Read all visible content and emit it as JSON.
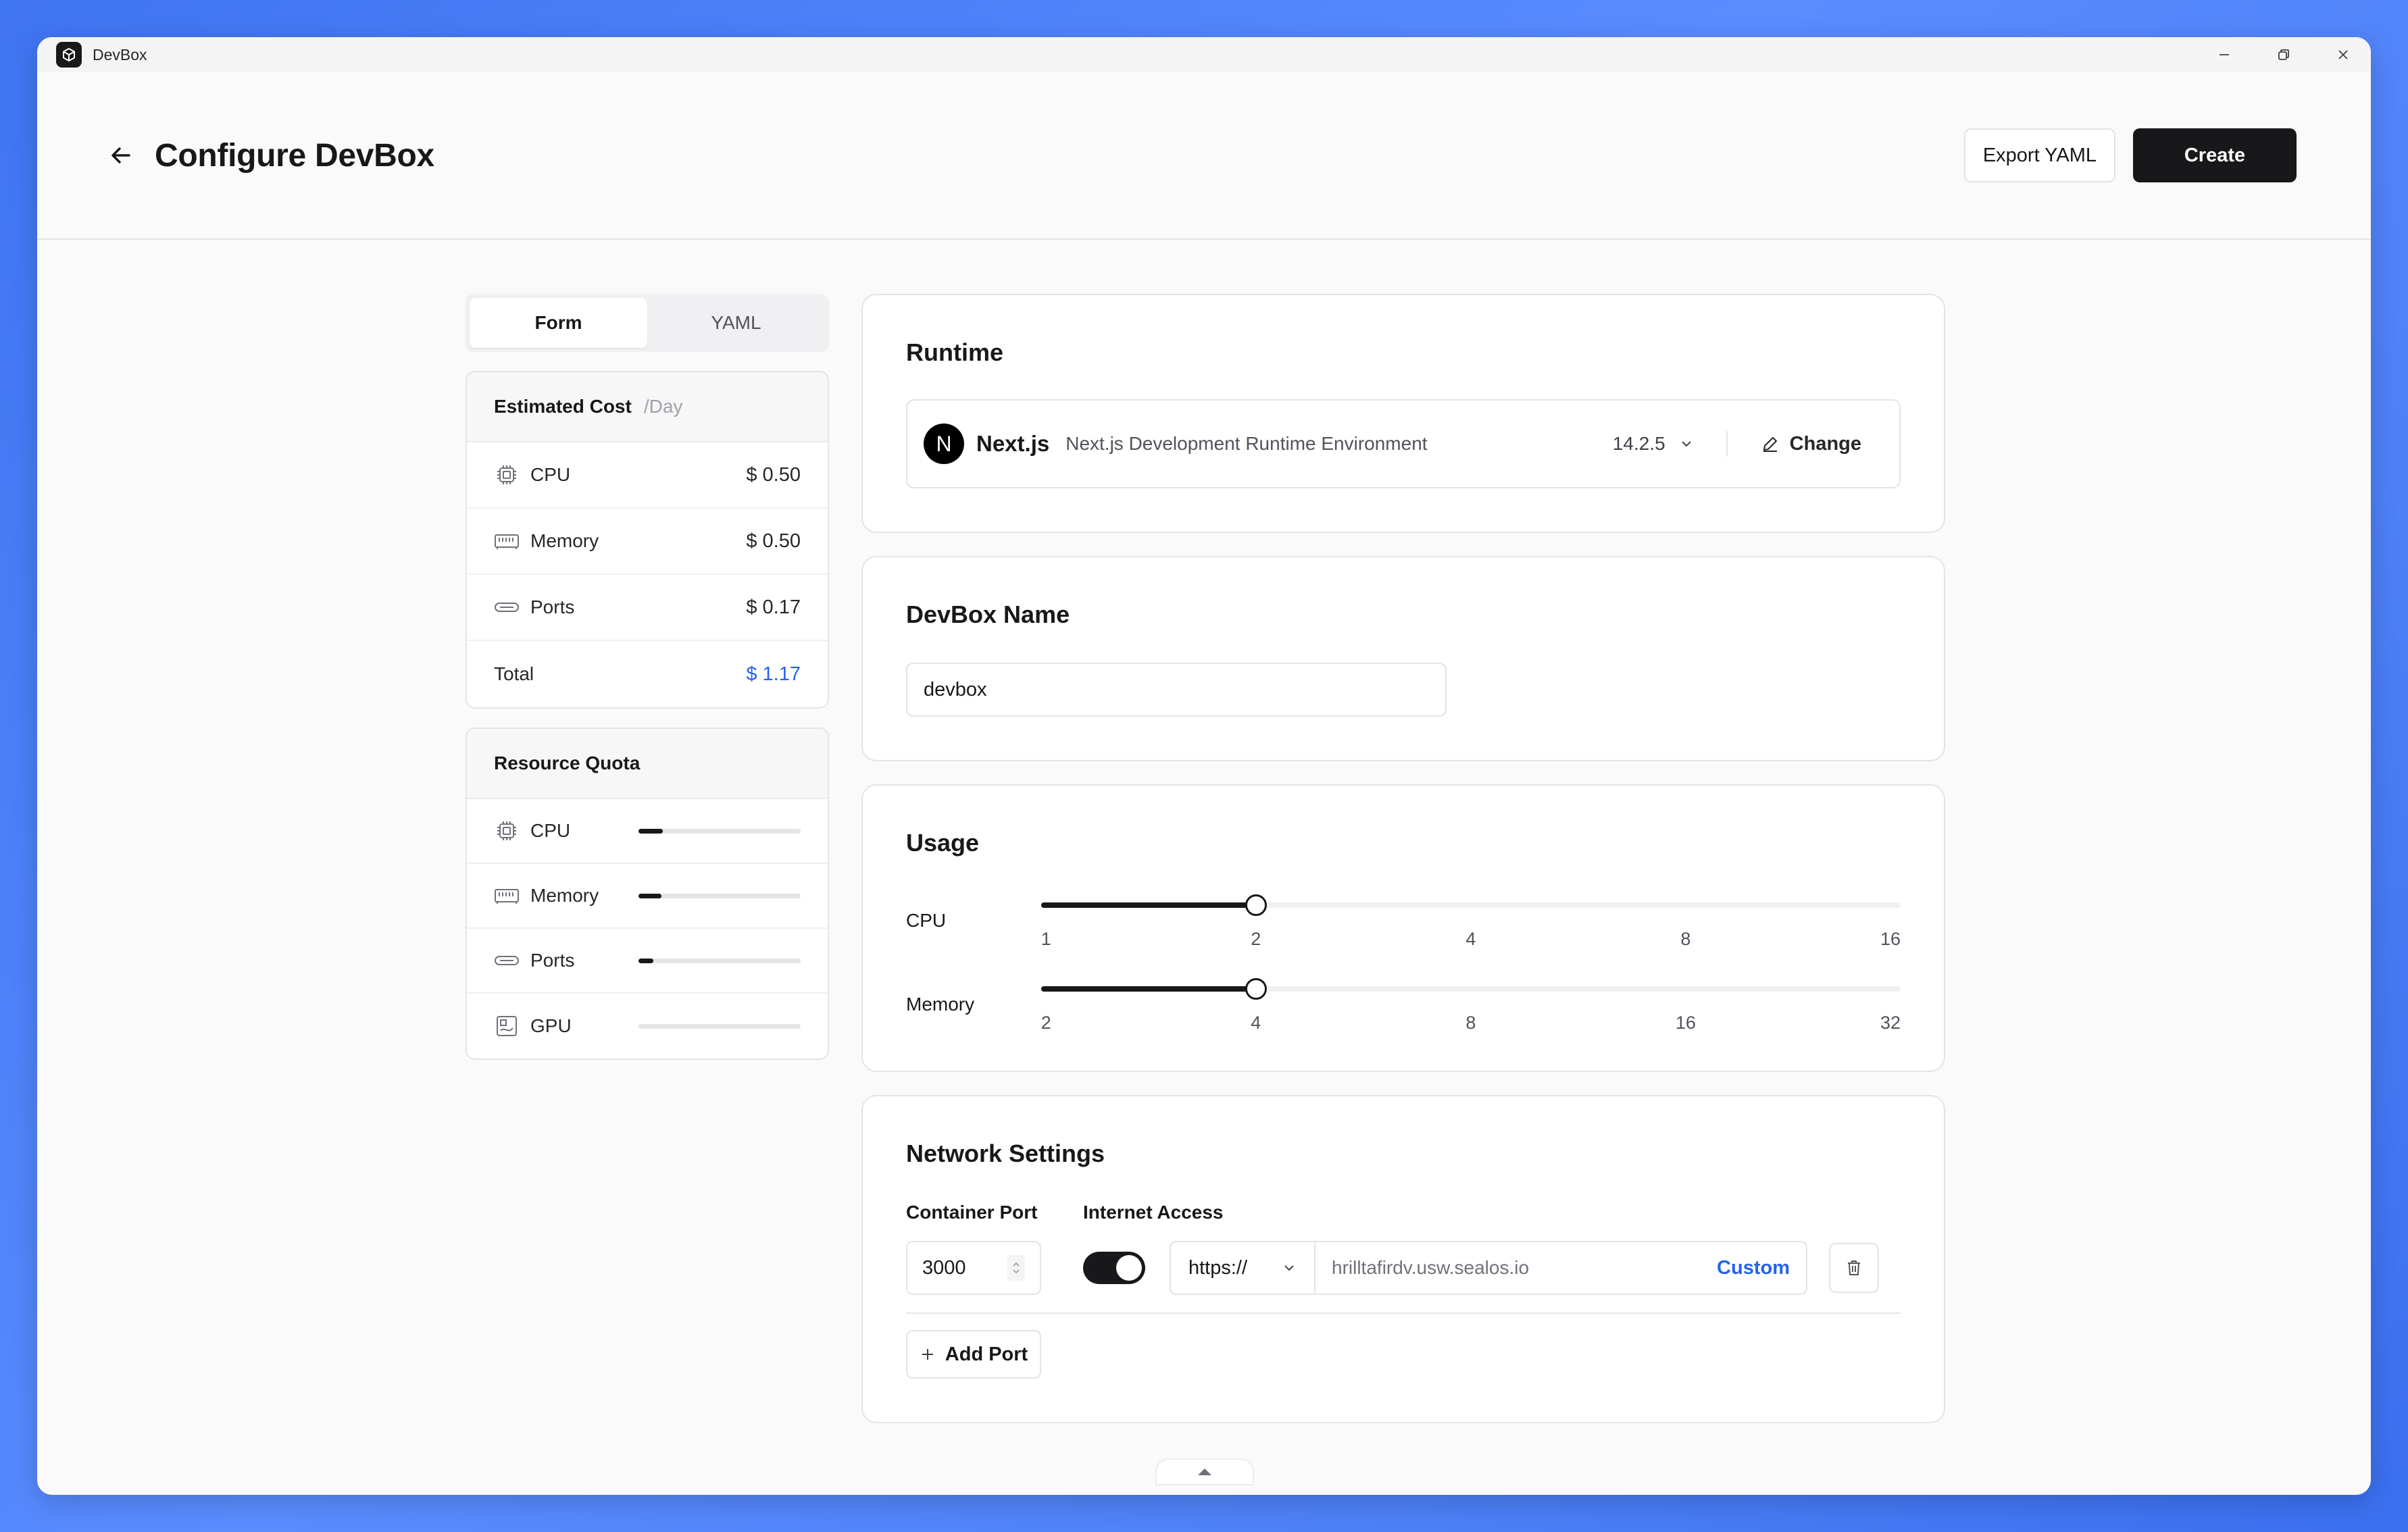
{
  "window": {
    "title": "DevBox"
  },
  "header": {
    "title": "Configure DevBox",
    "export_label": "Export YAML",
    "create_label": "Create"
  },
  "tabs": [
    {
      "label": "Form",
      "active": true
    },
    {
      "label": "YAML",
      "active": false
    }
  ],
  "cost": {
    "title": "Estimated Cost",
    "unit": "/Day",
    "items": [
      {
        "icon": "cpu-icon",
        "label": "CPU",
        "value": "$ 0.50"
      },
      {
        "icon": "memory-icon",
        "label": "Memory",
        "value": "$ 0.50"
      },
      {
        "icon": "port-icon",
        "label": "Ports",
        "value": "$ 0.17"
      }
    ],
    "total_label": "Total",
    "total_value": "$ 1.17",
    "accent_color": "#2563eb"
  },
  "quota": {
    "title": "Resource Quota",
    "items": [
      {
        "icon": "cpu-icon",
        "label": "CPU",
        "usage_fraction": 0.15
      },
      {
        "icon": "memory-icon",
        "label": "Memory",
        "usage_fraction": 0.14
      },
      {
        "icon": "port-icon",
        "label": "Ports",
        "usage_fraction": 0.09
      },
      {
        "icon": "gpu-icon",
        "label": "GPU",
        "usage_fraction": 0.0
      }
    ]
  },
  "runtime": {
    "title": "Runtime",
    "name": "Next.js",
    "logo_letter": "N",
    "description": "Next.js Development Runtime Environment",
    "version": "14.2.5",
    "change_label": "Change"
  },
  "devbox_name": {
    "title": "DevBox Name",
    "value": "devbox"
  },
  "usage": {
    "title": "Usage",
    "cpu": {
      "label": "CPU",
      "ticks": [
        "1",
        "2",
        "4",
        "8",
        "16"
      ],
      "selected_index": 1
    },
    "memory": {
      "label": "Memory",
      "ticks": [
        "2",
        "4",
        "8",
        "16",
        "32"
      ],
      "selected_index": 1
    }
  },
  "network": {
    "title": "Network Settings",
    "port_label": "Container Port",
    "access_label": "Internet Access",
    "port_value": "3000",
    "internet_access": true,
    "protocol": "https://",
    "domain": "hrilltafirdv.usw.sealos.io",
    "custom_label": "Custom",
    "add_port_label": "Add Port"
  }
}
